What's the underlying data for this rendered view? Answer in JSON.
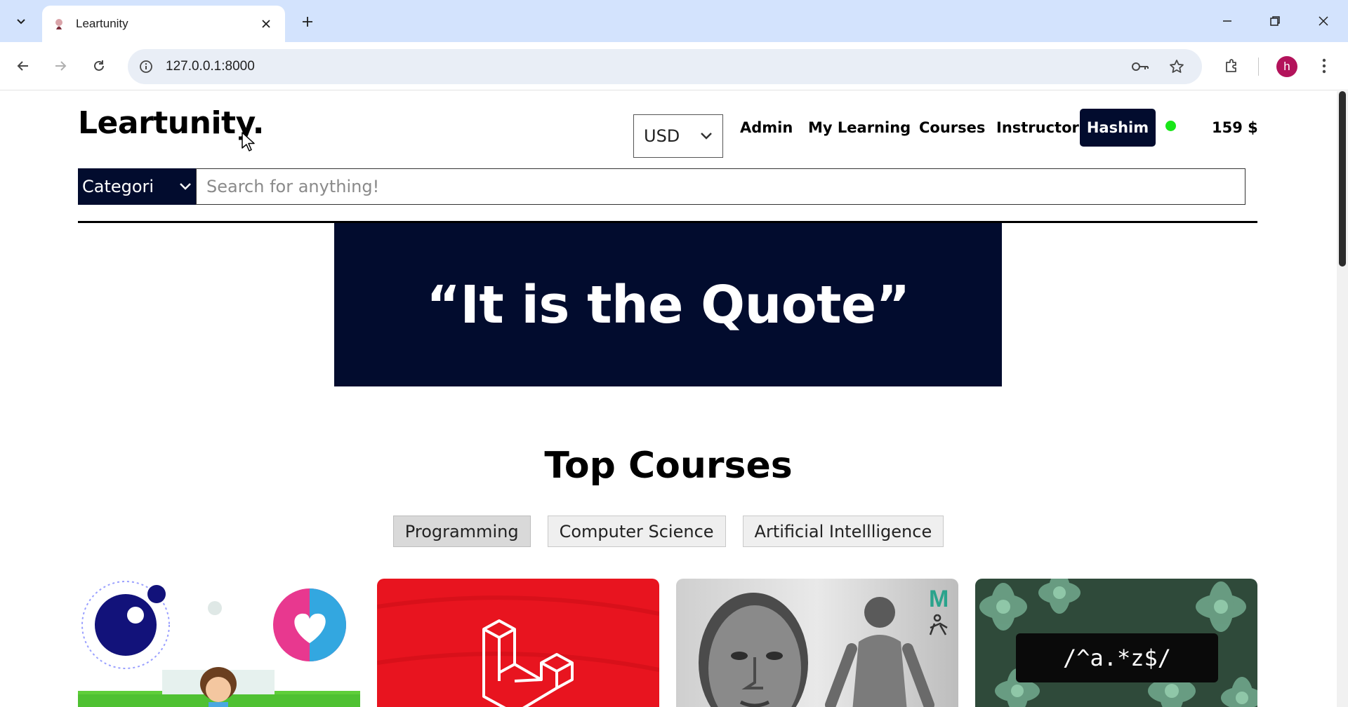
{
  "browser": {
    "tab_title": "Leartunity",
    "url": "127.0.0.1:8000",
    "profile_initial": "h"
  },
  "header": {
    "logo": "Leartunity.",
    "currency": "USD",
    "nav": [
      "Admin",
      "My Learning",
      "Courses",
      "Instructor"
    ],
    "user_name": "Hashim",
    "balance": "159 $"
  },
  "search": {
    "category_label": "Categori",
    "placeholder": "Search for anything!"
  },
  "hero": {
    "quote": "“It is the Quote”"
  },
  "top_courses": {
    "title": "Top Courses",
    "filters": [
      "Programming",
      "Computer Science",
      "Artificial Intellligence"
    ],
    "active_filter": "Programming",
    "cards": [
      {
        "thumbnail": "cartoon-bubbles"
      },
      {
        "thumbnail": "laravel-logo"
      },
      {
        "thumbnail": "3d-character-sculpt",
        "badge": "M"
      },
      {
        "thumbnail": "regex-succulents",
        "code": "/^a.*z$/"
      }
    ]
  },
  "colors": {
    "navy": "#020c2e",
    "online": "#19e619",
    "laravel_red": "#e8141f",
    "tab_strip": "#d3e3fd"
  }
}
